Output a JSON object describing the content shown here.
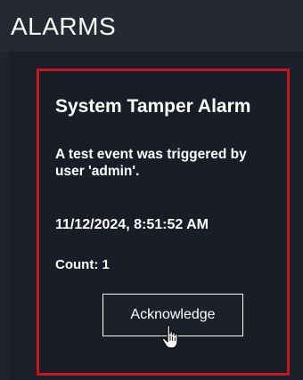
{
  "panel": {
    "title": "ALARMS"
  },
  "alarm": {
    "title": "System Tamper Alarm",
    "message": "A test event was triggered by user 'admin'.",
    "timestamp": "11/12/2024, 8:51:52 AM",
    "count": "Count: 1",
    "acknowledge_label": "Acknowledge",
    "border_color": "#c8161d"
  },
  "icons": {
    "cursor": "hand-pointer-icon"
  }
}
